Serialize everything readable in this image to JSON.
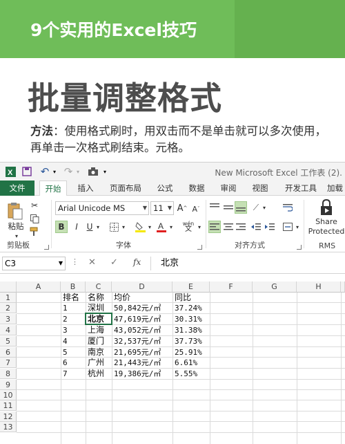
{
  "banner": {
    "title": "9个实用的Excel技巧"
  },
  "heading": "批量调整格式",
  "method": {
    "label": "方法",
    "text": "：使用格式刷时，用双击而不是单击就可以多次使用，再单击一次格式刷结束。元格。"
  },
  "window": {
    "title": "New Microsoft Excel 工作表 (2)."
  },
  "tabs": [
    "文件",
    "开始",
    "插入",
    "页面布局",
    "公式",
    "数据",
    "审阅",
    "视图",
    "开发工具",
    "加载"
  ],
  "ribbon": {
    "clipboard": {
      "paste": "粘贴",
      "label": "剪贴板"
    },
    "font": {
      "name": "Arial Unicode MS",
      "size": "11",
      "grow": "A",
      "shrink": "A",
      "bold": "B",
      "italic": "I",
      "underline": "U",
      "phonetic": "wén",
      "label": "字体"
    },
    "align": {
      "label": "对齐方式"
    },
    "rms": {
      "share": "Share",
      "protected": "Protected",
      "label": "RMS"
    }
  },
  "formula_bar": {
    "name_box": "C3",
    "fx": "fx",
    "value": "北京"
  },
  "columns": [
    "A",
    "B",
    "C",
    "D",
    "E",
    "F",
    "G",
    "H"
  ],
  "rows": [
    "1",
    "2",
    "3",
    "4",
    "5",
    "6",
    "7",
    "8",
    "9",
    "10",
    "11",
    "12",
    "13"
  ],
  "table": {
    "headers": [
      "排名",
      "名称",
      "均价",
      "同比"
    ],
    "data": [
      [
        "1",
        "深圳",
        "50,842元/㎡",
        "37.24%"
      ],
      [
        "2",
        "北京",
        "47,619元/㎡",
        "30.31%"
      ],
      [
        "3",
        "上海",
        "43,052元/㎡",
        "31.38%"
      ],
      [
        "4",
        "厦门",
        "32,537元/㎡",
        "37.73%"
      ],
      [
        "5",
        "南京",
        "21,695元/㎡",
        "25.91%"
      ],
      [
        "6",
        "广州",
        "21,443元/㎡",
        "6.61%"
      ],
      [
        "7",
        "杭州",
        "19,386元/㎡",
        "5.55%"
      ]
    ]
  },
  "colors": {
    "banner": "#6fbd59",
    "excel_green": "#217346",
    "selection": "#c5e0b4"
  }
}
